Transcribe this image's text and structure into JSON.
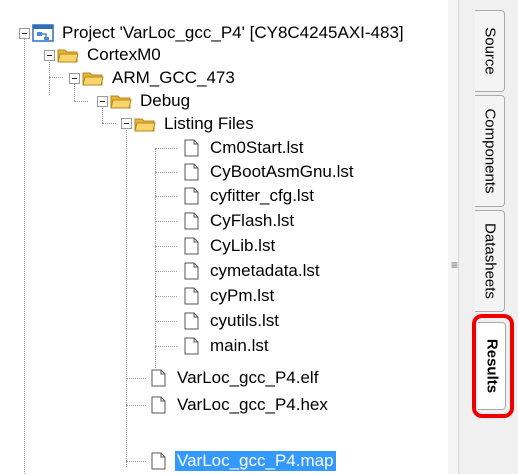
{
  "tree": {
    "project": "Project 'VarLoc_gcc_P4' [CY8C4245AXI-483]",
    "core": "CortexM0",
    "toolchain": "ARM_GCC_473",
    "config": "Debug",
    "listing_folder": "Listing Files",
    "listing_files": [
      "Cm0Start.lst",
      "CyBootAsmGnu.lst",
      "cyfitter_cfg.lst",
      "CyFlash.lst",
      "CyLib.lst",
      "cymetadata.lst",
      "cyPm.lst",
      "cyutils.lst",
      "main.lst"
    ],
    "output_files": [
      "VarLoc_gcc_P4.elf",
      "VarLoc_gcc_P4.hex",
      "VarLoc_gcc_P4.map"
    ],
    "selected": "VarLoc_gcc_P4.map"
  },
  "tabs": [
    {
      "label": "Source",
      "active": false
    },
    {
      "label": "Components",
      "active": false
    },
    {
      "label": "Datasheets",
      "active": false
    },
    {
      "label": "Results",
      "active": true
    }
  ],
  "splitter_grip": "≡",
  "colors": {
    "folder": "#f0c84a",
    "selection": "#3399ff",
    "highlight": "#ee0000",
    "project_icon": "#2f6db5"
  },
  "icons": {
    "project": "project-icon",
    "folder": "folder-icon",
    "file": "file-icon",
    "toggle": "collapse-toggle-icon"
  }
}
